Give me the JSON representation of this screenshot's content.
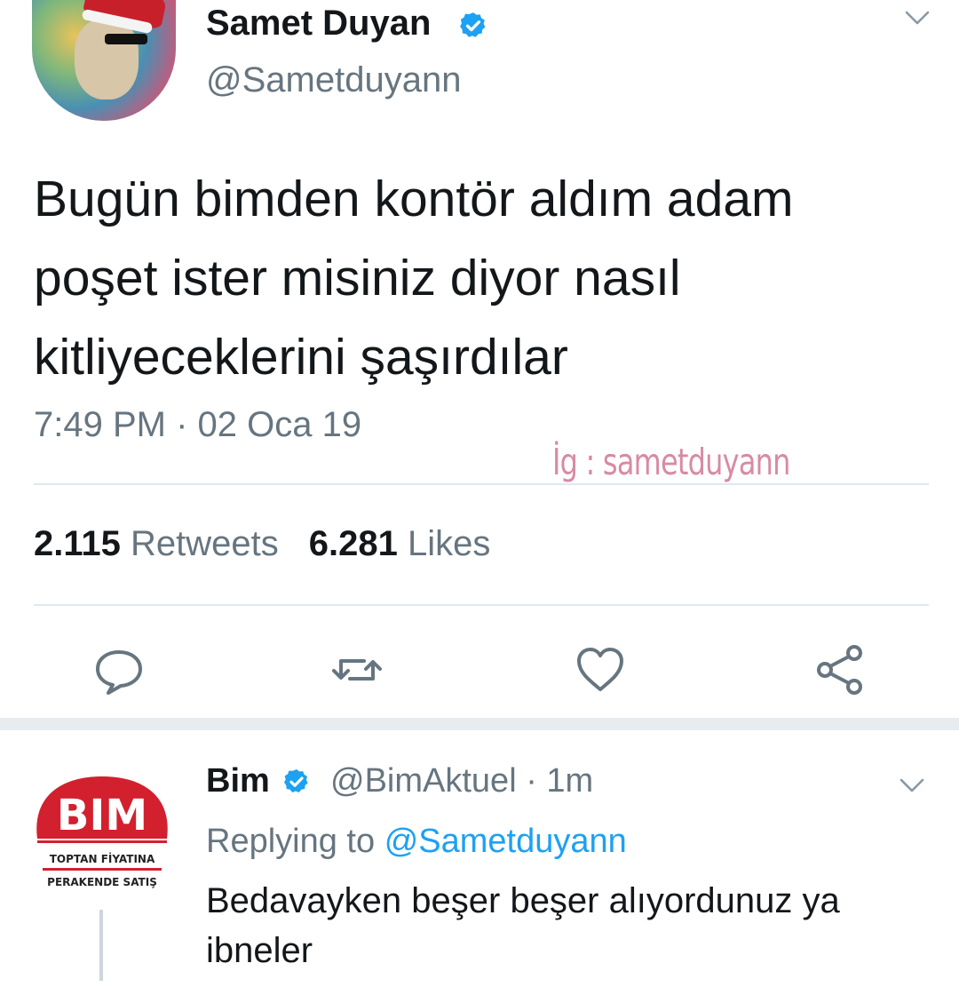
{
  "tweet": {
    "display_name": "Samet Duyan",
    "handle": "@Sametduyann",
    "text_lines": [
      "Bugün bimden kontör aldım adam",
      "poşet ister misiniz diyor nasıl",
      "kitliyeceklerini şaşırdılar"
    ],
    "timestamp": "7:49 PM · 02 Oca 19",
    "watermark": "İg : sametduyann",
    "retweets_count": "2.115",
    "retweets_label": "Retweets",
    "likes_count": "6.281",
    "likes_label": "Likes",
    "actions": [
      "reply-icon",
      "retweet-icon",
      "like-icon",
      "share-icon"
    ]
  },
  "reply": {
    "display_name": "Bim",
    "meta": "@BimAktuel · 1m",
    "replying_prefix": "Replying to",
    "replying_handle": "@Sametduyann",
    "text_lines": [
      "Bedavayken beşer beşer alıyordunuz ya",
      "ibneler"
    ],
    "logo": {
      "wordmark": "BIM",
      "tagline_top": "TOPTAN FİYATINA",
      "tagline_bottom": "PERAKENDE SATIŞ"
    }
  },
  "colors": {
    "verified_blue": "#1da1f2",
    "text_primary": "#14171a",
    "text_secondary": "#66757f",
    "divider": "#e1e8ed",
    "watermark": "#d88aa5",
    "bim_red": "#d2202f"
  }
}
